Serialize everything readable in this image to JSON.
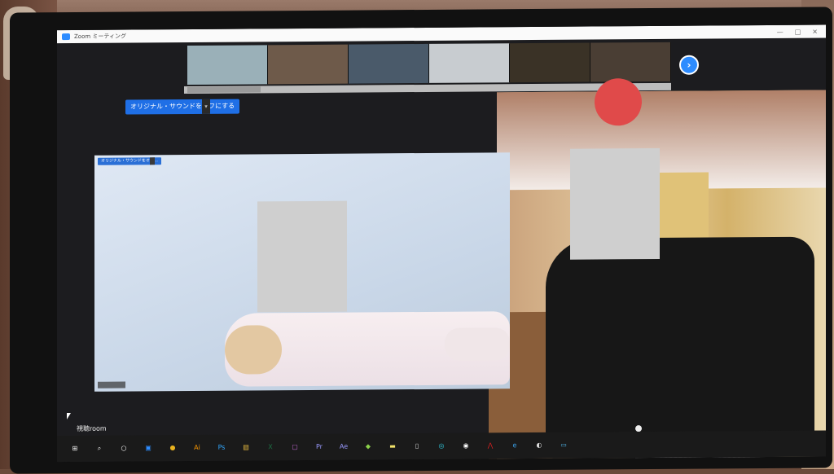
{
  "window": {
    "title": "Zoom ミーティング",
    "controls": [
      "—",
      "□",
      "✕"
    ]
  },
  "toolbar": {
    "sound_button_label": "オリジナル・サウンドをオフにする",
    "dropdown_glyph": "▾"
  },
  "main_video": {
    "label": "オリジナル・サウンドをオン…"
  },
  "taskbar": {
    "tooltip": "視聴room",
    "items": [
      {
        "name": "windows-start",
        "glyph": "⊞",
        "color": "#ffffff"
      },
      {
        "name": "search",
        "glyph": "⌕",
        "color": "#ffffff"
      },
      {
        "name": "task-view",
        "glyph": "○",
        "color": "#ffffff"
      },
      {
        "name": "zoom",
        "glyph": "▣",
        "color": "#2d8cff"
      },
      {
        "name": "chrome",
        "glyph": "●",
        "color": "#e8b21f"
      },
      {
        "name": "illustrator",
        "glyph": "Ai",
        "color": "#ff9a00"
      },
      {
        "name": "photoshop",
        "glyph": "Ps",
        "color": "#31a8ff"
      },
      {
        "name": "file-explorer",
        "glyph": "▤",
        "color": "#f5c542"
      },
      {
        "name": "excel",
        "glyph": "X",
        "color": "#1d7044"
      },
      {
        "name": "photos",
        "glyph": "▢",
        "color": "#c86ad8"
      },
      {
        "name": "premiere",
        "glyph": "Pr",
        "color": "#9999ff"
      },
      {
        "name": "after-effects",
        "glyph": "Ae",
        "color": "#9999ff"
      },
      {
        "name": "app",
        "glyph": "◆",
        "color": "#8bd14a"
      },
      {
        "name": "sticky-notes",
        "glyph": "▬",
        "color": "#f2e36b"
      },
      {
        "name": "notepad",
        "glyph": "▯",
        "color": "#dddddd"
      },
      {
        "name": "app-teal",
        "glyph": "◎",
        "color": "#2fc4d8"
      },
      {
        "name": "app-white",
        "glyph": "◉",
        "color": "#ffffff"
      },
      {
        "name": "acrobat",
        "glyph": "⋀",
        "color": "#e02020"
      },
      {
        "name": "edge",
        "glyph": "e",
        "color": "#3aa0e8"
      },
      {
        "name": "app-gray",
        "glyph": "◐",
        "color": "#dddddd"
      },
      {
        "name": "app-blue",
        "glyph": "▭",
        "color": "#4fb3e6"
      }
    ]
  },
  "video_strip_colors": [
    "#9ab0b8",
    "#6e5a4a",
    "#4a5a6a",
    "#c8ccd0",
    "#3a3226",
    "#4a3e34"
  ],
  "next_glyph": "›"
}
